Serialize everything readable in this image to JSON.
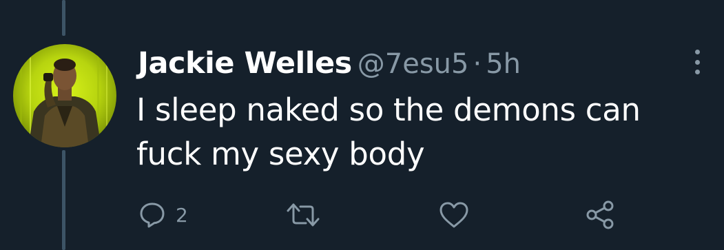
{
  "tweet": {
    "display_name": "Jackie Welles",
    "handle": "@7esu5",
    "separator": "·",
    "time": "5h",
    "text": "I sleep naked so the demons can fuck my sexy body"
  },
  "actions": {
    "reply": {
      "icon": "reply-icon",
      "count": "2"
    },
    "retweet": {
      "icon": "retweet-icon"
    },
    "like": {
      "icon": "heart-icon"
    },
    "share": {
      "icon": "share-icon"
    }
  },
  "colors": {
    "background": "#15202b",
    "text_primary": "#ffffff",
    "text_secondary": "#8899a6",
    "thread_line": "#3d5466",
    "avatar_accent": "#c8e615"
  }
}
